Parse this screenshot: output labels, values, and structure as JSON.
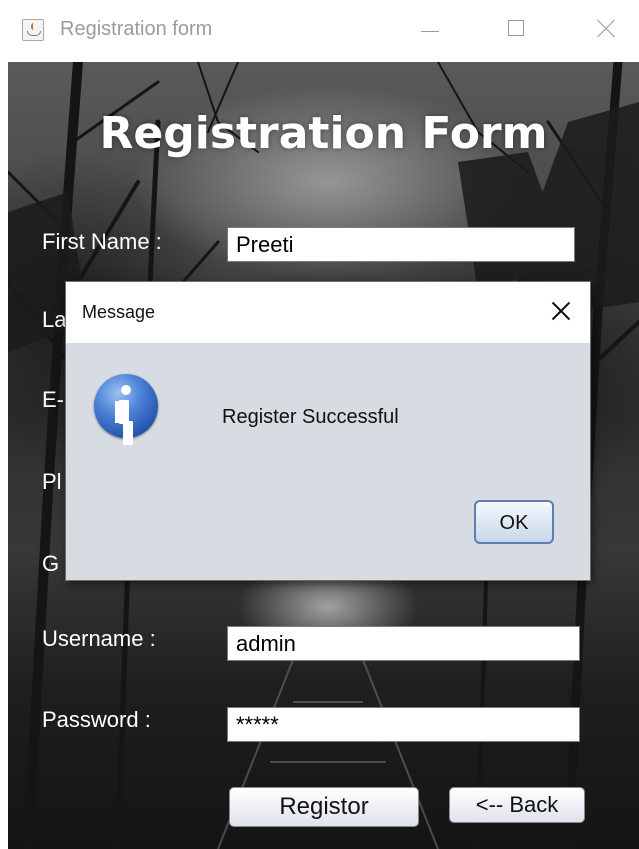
{
  "window": {
    "title": "Registration form",
    "controls": [
      "minimize-icon",
      "maximize-icon",
      "close-icon"
    ]
  },
  "form": {
    "heading": "Registration Form",
    "fields": {
      "first_name": {
        "label": "First Name :",
        "value": "Preeti"
      },
      "last_name": {
        "label_visible": "La"
      },
      "email": {
        "label_visible": "E-"
      },
      "phone": {
        "label_visible": "Pl"
      },
      "gender": {
        "label_visible": "G"
      },
      "username": {
        "label": "Username :",
        "value": "admin"
      },
      "password": {
        "label": "Password :",
        "value": "*****"
      }
    },
    "register_button": "Registor",
    "back_button": "<-- Back"
  },
  "dialog": {
    "title": "Message",
    "message": "Register Successful",
    "ok_button": "OK",
    "icon": "info-icon"
  },
  "colors": {
    "background": "#2f2f2f",
    "dialog": "#d7dbe2",
    "info_icon": "#2b5fbf"
  }
}
